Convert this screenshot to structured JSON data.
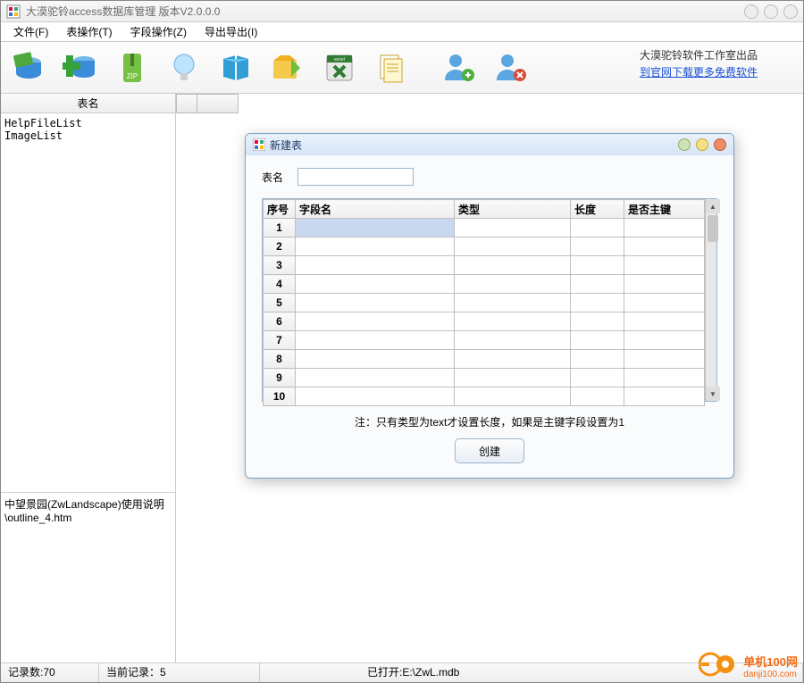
{
  "window": {
    "title": "大漠驼铃access数据库管理 版本V2.0.0.0"
  },
  "menu": {
    "file": "文件(F)",
    "table": "表操作(T)",
    "field": "字段操作(Z)",
    "export": "导出导出(I)"
  },
  "toolbar": {
    "promo_label": "大漠驼铃软件工作室出品",
    "promo_link": "到官网下载更多免费软件"
  },
  "sidebar": {
    "header": "表名",
    "tables": [
      "HelpFileList",
      "ImageList"
    ],
    "detail": "中望景园(ZwLandscape)使用说明\\outline_4.htm"
  },
  "dialog": {
    "title": "新建表",
    "table_name_label": "表名",
    "table_name_value": "",
    "columns": {
      "index": "序号",
      "name": "字段名",
      "type": "类型",
      "length": "长度",
      "pk": "是否主键"
    },
    "rows": [
      {
        "n": "1",
        "name": "",
        "type": "",
        "length": "",
        "pk": "",
        "sel": true
      },
      {
        "n": "2",
        "name": "",
        "type": "",
        "length": "",
        "pk": "",
        "sel": false
      },
      {
        "n": "3",
        "name": "",
        "type": "",
        "length": "",
        "pk": "",
        "sel": false
      },
      {
        "n": "4",
        "name": "",
        "type": "",
        "length": "",
        "pk": "",
        "sel": false
      },
      {
        "n": "5",
        "name": "",
        "type": "",
        "length": "",
        "pk": "",
        "sel": false
      },
      {
        "n": "6",
        "name": "",
        "type": "",
        "length": "",
        "pk": "",
        "sel": false
      },
      {
        "n": "7",
        "name": "",
        "type": "",
        "length": "",
        "pk": "",
        "sel": false
      },
      {
        "n": "8",
        "name": "",
        "type": "",
        "length": "",
        "pk": "",
        "sel": false
      },
      {
        "n": "9",
        "name": "",
        "type": "",
        "length": "",
        "pk": "",
        "sel": false
      },
      {
        "n": "10",
        "name": "",
        "type": "",
        "length": "",
        "pk": "",
        "sel": false
      }
    ],
    "note": "注：只有类型为text才设置长度，如果是主键字段设置为1",
    "create_btn": "创建"
  },
  "statusbar": {
    "count": "记录数:70",
    "current": "当前记录：5",
    "opened": "已打开:E:\\ZwL.mdb"
  },
  "watermark": {
    "line1": "单机100网",
    "line2": "danji100.com"
  }
}
